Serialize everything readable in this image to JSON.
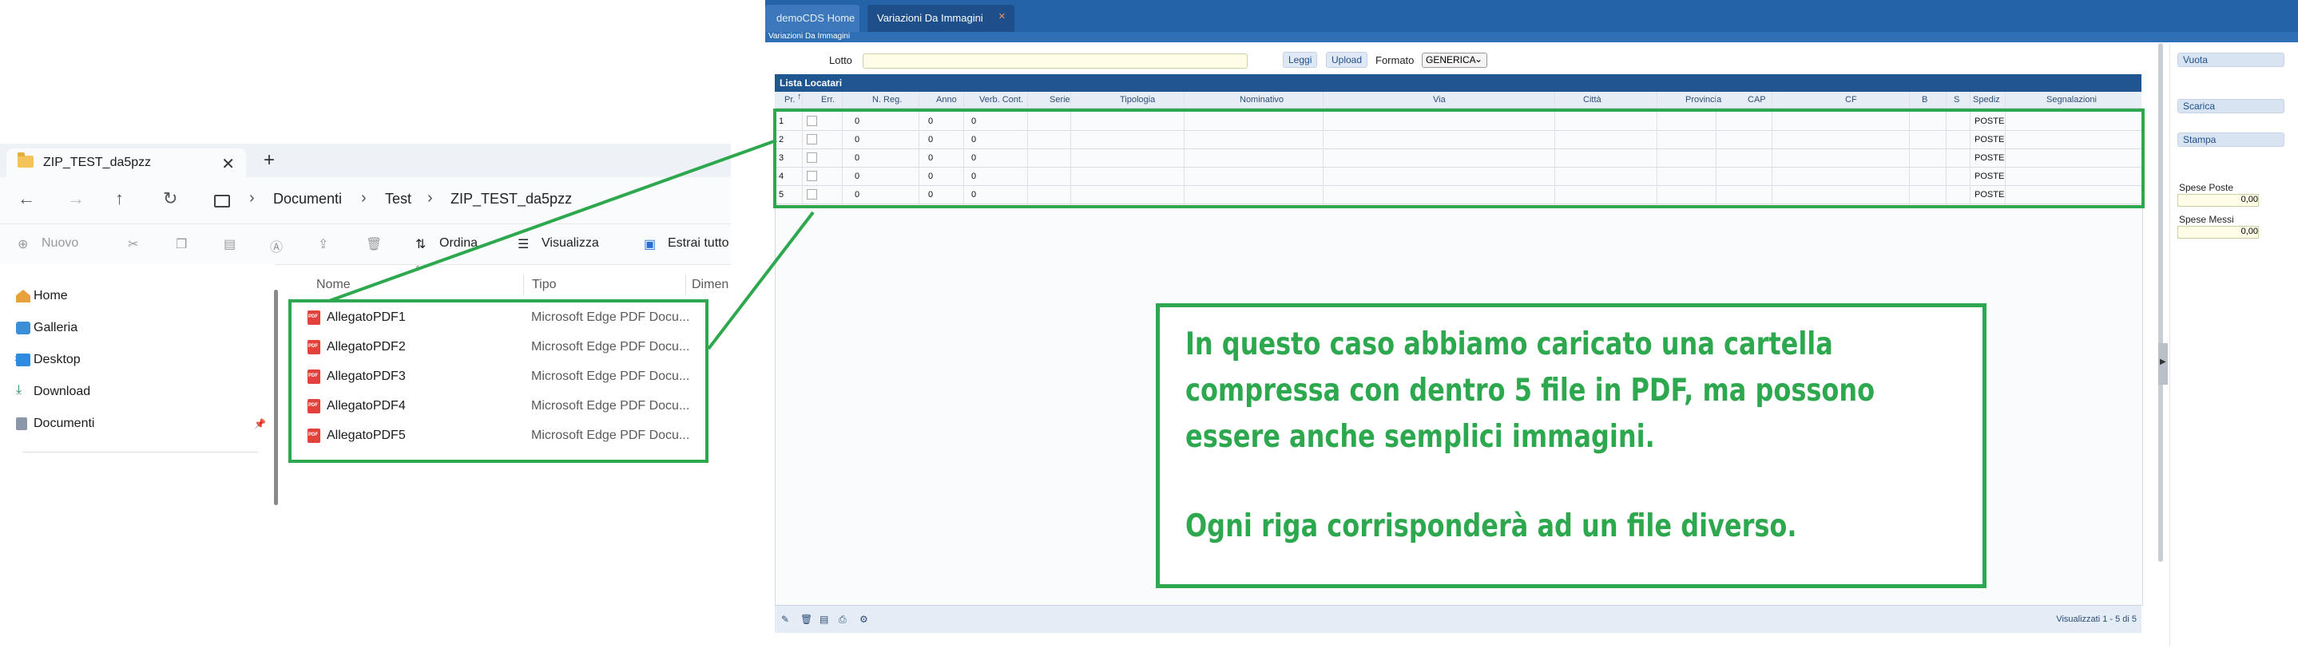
{
  "explorer": {
    "tab_title": "ZIP_TEST_da5pzz",
    "tab_close": "✕",
    "new_tab": "+",
    "breadcrumbs": [
      "Documenti",
      "Test",
      "ZIP_TEST_da5pzz"
    ],
    "breadcrumb_sep": "›",
    "toolbar": {
      "new": "Nuovo",
      "sort": "Ordina",
      "view": "Visualizza",
      "extract": "Estrai tutto"
    },
    "sidebar": [
      "Home",
      "Galleria",
      "Desktop",
      "Download",
      "Documenti"
    ],
    "columns": {
      "name": "Nome",
      "type": "Tipo",
      "size": "Dimen"
    },
    "files": [
      {
        "name": "AllegatoPDF1",
        "type": "Microsoft Edge PDF Docu..."
      },
      {
        "name": "AllegatoPDF2",
        "type": "Microsoft Edge PDF Docu..."
      },
      {
        "name": "AllegatoPDF3",
        "type": "Microsoft Edge PDF Docu..."
      },
      {
        "name": "AllegatoPDF4",
        "type": "Microsoft Edge PDF Docu..."
      },
      {
        "name": "AllegatoPDF5",
        "type": "Microsoft Edge PDF Docu..."
      }
    ]
  },
  "app": {
    "tabs": [
      "demoCDS Home",
      "Variazioni Da Immagini"
    ],
    "tab_close": "×",
    "subtitle": "Variazioni Da Immagini",
    "lotto_label": "Lotto",
    "leggi": "Leggi",
    "upload": "Upload",
    "formato_label": "Formato",
    "formato_value": "GENERICA",
    "grid_title": "Lista Locatari",
    "columns": [
      "Pr.",
      "Err.",
      "N. Reg.",
      "Anno",
      "Verb. Cont.",
      "Serie",
      "Tipologia",
      "Nominativo",
      "Via",
      "Città",
      "Provincia",
      "CAP",
      "CF",
      "B",
      "S",
      "Spediz",
      "Segnalazioni"
    ],
    "rows": [
      {
        "pr": "1",
        "nreg": "0",
        "anno": "0",
        "verb": "0",
        "sped": "POSTE"
      },
      {
        "pr": "2",
        "nreg": "0",
        "anno": "0",
        "verb": "0",
        "sped": "POSTE"
      },
      {
        "pr": "3",
        "nreg": "0",
        "anno": "0",
        "verb": "0",
        "sped": "POSTE"
      },
      {
        "pr": "4",
        "nreg": "0",
        "anno": "0",
        "verb": "0",
        "sped": "POSTE"
      },
      {
        "pr": "5",
        "nreg": "0",
        "anno": "0",
        "verb": "0",
        "sped": "POSTE"
      }
    ],
    "footer_status": "Visualizzati 1 - 5 di 5",
    "right": {
      "vuota": "Vuota",
      "scarica": "Scarica",
      "stampa": "Stampa",
      "spese_poste_label": "Spese Poste",
      "spese_poste": "0,00",
      "spese_messi_label": "Spese Messi",
      "spese_messi": "0,00"
    }
  },
  "annotation": {
    "lines": [
      "In questo caso abbiamo caricato una cartella",
      "compressa con dentro 5 file in PDF, ma possono",
      "essere anche semplici immagini.",
      "Ogni riga corrisponderà ad un file diverso."
    ]
  },
  "colors": {
    "highlight": "#2ea84e",
    "app_blue": "#2563a8"
  }
}
